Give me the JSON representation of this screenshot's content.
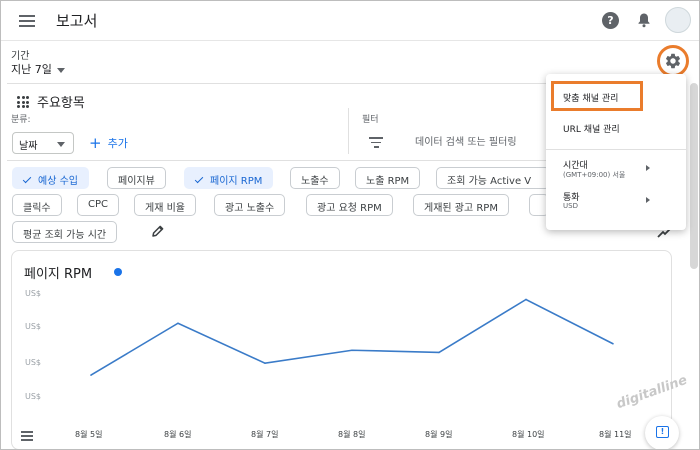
{
  "app": {
    "title": "보고서"
  },
  "header": {
    "help_glyph": "?"
  },
  "period": {
    "label": "기간",
    "value": "지난 7일"
  },
  "dimensions": {
    "title": "주요항목",
    "breakdown_label": "분류:",
    "date_select": "날짜",
    "add_label": "추가",
    "filter_label": "필터",
    "filter_placeholder": "데이터 검색 또는 필터링"
  },
  "chips": [
    {
      "label": "예상 수입",
      "selected": true
    },
    {
      "label": "페이지뷰",
      "selected": false
    },
    {
      "label": "페이지 RPM",
      "selected": true
    },
    {
      "label": "노출수",
      "selected": false
    },
    {
      "label": "노출 RPM",
      "selected": false
    },
    {
      "label": "조회 가능 Active V",
      "selected": false
    },
    {
      "label": "클릭수",
      "selected": false
    },
    {
      "label": "CPC",
      "selected": false
    },
    {
      "label": "게재 비율",
      "selected": false
    },
    {
      "label": "광고 노출수",
      "selected": false
    },
    {
      "label": "광고 요청 RPM",
      "selected": false
    },
    {
      "label": "게재된 광고 RPM",
      "selected": false
    },
    {
      "label": "",
      "selected": false
    },
    {
      "label": "평균 조회 가능 시간",
      "selected": false
    }
  ],
  "menu": {
    "items": [
      {
        "label": "맞춤 채널 관리",
        "sub": "",
        "has_submenu": false
      },
      {
        "label": "URL 채널 관리",
        "sub": "",
        "has_submenu": false
      },
      {
        "label": "시간대",
        "sub": "(GMT+09:00) 서울",
        "has_submenu": true
      },
      {
        "label": "통화",
        "sub": "USD",
        "has_submenu": true
      }
    ]
  },
  "chart_data": {
    "type": "line",
    "title": "페이지 RPM",
    "x": [
      "8월 5일",
      "8월 6일",
      "8월 7일",
      "8월 8일",
      "8월 9일",
      "8월 10일",
      "8월 11일"
    ],
    "y_tick_labels": [
      "US$",
      "US$",
      "US$",
      "US$"
    ],
    "series": [
      {
        "values": [
          0.24,
          0.72,
          0.35,
          0.47,
          0.45,
          0.94,
          0.53
        ]
      }
    ],
    "ylim": [
      0,
      1
    ],
    "color": "#3a7bc8",
    "grid": false
  },
  "watermark": "digitalline",
  "colors": {
    "accent": "#1a73e8",
    "highlight": "#ea7c2c",
    "chip_selected_bg": "#e8f0fe"
  }
}
